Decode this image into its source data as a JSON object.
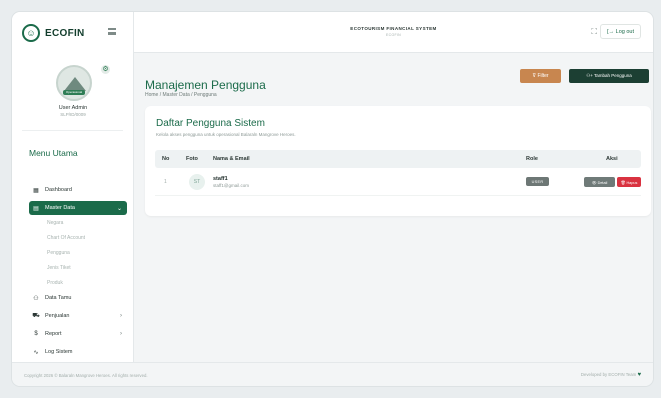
{
  "brand": {
    "name": "ECOFIN",
    "logo_glyph": "☺"
  },
  "profile": {
    "name": "User Admin",
    "id": "SLP/ID/0009",
    "avatar_badge": "Operasional"
  },
  "menu": {
    "title": "Menu Utama",
    "items": [
      {
        "label": "Dashboard",
        "icon": "dashboard-icon",
        "glyph": "▦"
      },
      {
        "label": "Master Data",
        "icon": "database-icon",
        "glyph": "▤",
        "active": true,
        "chevron": "⌄"
      },
      {
        "label": "Data Tamu",
        "icon": "users-icon",
        "glyph": "⚇"
      },
      {
        "label": "Penjualan",
        "icon": "cart-icon",
        "glyph": "⛟",
        "chevron": "›"
      },
      {
        "label": "Report",
        "icon": "dollar-icon",
        "glyph": "$",
        "chevron": "›"
      },
      {
        "label": "Log Sistem",
        "icon": "activity-icon",
        "glyph": "∿"
      }
    ],
    "subitems": [
      "Negara",
      "Chart Of Account",
      "Pengguna",
      "Jenis Tiket",
      "Produk"
    ]
  },
  "topbar": {
    "title": "ECOTOURISM FINANCIAL SYSTEM",
    "subtitle": "ECOFIN",
    "expand_glyph": "⛶",
    "logout_label": "[→ Log out"
  },
  "page": {
    "title": "Manajemen Pengguna",
    "breadcrumb": "Home / Master Data / Pengguna",
    "filter_label": "⊽ Filter",
    "add_label": "⚇+ Tambah Pengguna"
  },
  "card": {
    "title": "Daftar Pengguna Sistem",
    "description": "Kelola akses pengguna untuk operasional Balaraln Mangrove Heroes.",
    "columns": [
      "No",
      "Foto",
      "Nama & Email",
      "Role",
      "Aksi"
    ],
    "rows": [
      {
        "no": "1",
        "initials": "ST",
        "name": "staff1",
        "email": "staff1@gmail.com",
        "role": "USER",
        "detail_label": "👁 Detail",
        "delete_label": "🗑 Hapus"
      }
    ]
  },
  "footer": {
    "copyright": "Copyright 2026 © Balaraln Mangrove Heroes. All rights reserved.",
    "developer": "Developed by ECOFIN Team",
    "heart_glyph": "♥"
  },
  "colors": {
    "primary": "#1b6b4a",
    "filter": "#c8864f",
    "add": "#1c3f33",
    "danger": "#d93240"
  }
}
